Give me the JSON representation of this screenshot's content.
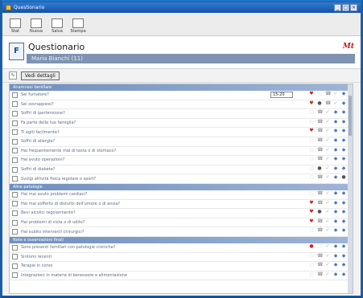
{
  "window": {
    "title": "Questionario",
    "buttons": [
      "_",
      "□",
      "×"
    ]
  },
  "toolbar": [
    {
      "label": "Stat"
    },
    {
      "label": "Nuova"
    },
    {
      "label": "Salva"
    },
    {
      "label": "Stampa"
    }
  ],
  "header": {
    "badge": "F",
    "title": "Questionario",
    "patient": "Maria Bianchi (11)",
    "logo": "Mt"
  },
  "actions": {
    "button": "Vedi dettagli"
  },
  "sections": [
    {
      "title": "Anamnesi familiare"
    },
    {
      "title": "Altre patologie"
    },
    {
      "title": "Note e osservazioni finali"
    }
  ],
  "rows": [
    {
      "text": "Sei fumatore?",
      "select": "15-20",
      "icons": [
        "heart",
        "ghost",
        "phone",
        "check",
        "blue"
      ]
    },
    {
      "text": "Sei sovrappeso?",
      "icons": [
        "heart",
        "dark",
        "phone",
        "check",
        "blue"
      ]
    },
    {
      "text": "Soffri di ipertensione?",
      "icons": [
        "ghost",
        "phone",
        "check",
        "blue",
        "blue"
      ]
    },
    {
      "text": "Fa parte della tua famiglia?",
      "icons": [
        "ghost",
        "phone",
        "check",
        "blue",
        "blue"
      ]
    },
    {
      "text": "Ti agiti facilmente?",
      "icons": [
        "heart",
        "phone",
        "check",
        "blue",
        "blue"
      ]
    },
    {
      "text": "Soffri di allergie?",
      "icons": [
        "ghost",
        "phone",
        "check",
        "blue",
        "blue"
      ]
    },
    {
      "text": "Hai frequentemente mal di testa o di stomaco?",
      "icons": [
        "ghost",
        "phone",
        "check",
        "blue",
        "blue"
      ]
    },
    {
      "text": "Hai avuto operazioni?",
      "icons": [
        "ghost",
        "phone",
        "check",
        "blue",
        "blue"
      ]
    },
    {
      "text": "Soffri di diabete?",
      "icons": [
        "ghost",
        "dark",
        "check",
        "blue",
        "blue"
      ]
    },
    {
      "text": "Svolgi attività fisica regolare o sport?",
      "icons": [
        "ghost",
        "phone",
        "check",
        "blue",
        "dark"
      ]
    },
    {
      "text": "Hai mai avuto problemi cardiaci?",
      "icons": [
        "ghost",
        "phone",
        "check",
        "blue",
        "blue"
      ]
    },
    {
      "text": "Hai mai sofferto di disturbi dell'umore o di ansia?",
      "icons": [
        "heart",
        "phone",
        "check",
        "blue",
        "blue"
      ]
    },
    {
      "text": "Bevi alcolici regolarmente?",
      "icons": [
        "heart",
        "dark",
        "check",
        "blue",
        "blue"
      ]
    },
    {
      "text": "Hai problemi di vista o di udito?",
      "icons": [
        "heart",
        "phone",
        "check",
        "blue",
        "blue"
      ]
    },
    {
      "text": "Hai subito interventi chirurgici?",
      "icons": [
        "ghost",
        "phone",
        "check",
        "blue",
        "blue"
      ]
    },
    {
      "text": "Sono presenti familiari con patologie croniche?",
      "icons": [
        "red",
        "ghost",
        "check",
        "blue",
        "blue"
      ]
    },
    {
      "text": "Sintomi recenti",
      "icons": [
        "ghost",
        "phone",
        "check",
        "blue",
        "blue"
      ]
    },
    {
      "text": "Terapie in corso",
      "icons": [
        "ghost",
        "phone",
        "check",
        "blue",
        "blue"
      ]
    },
    {
      "text": "Integrazioni in materia di benessere e alimentazione",
      "icons": [
        "ghost",
        "phone",
        "check",
        "blue",
        "blue"
      ]
    }
  ]
}
